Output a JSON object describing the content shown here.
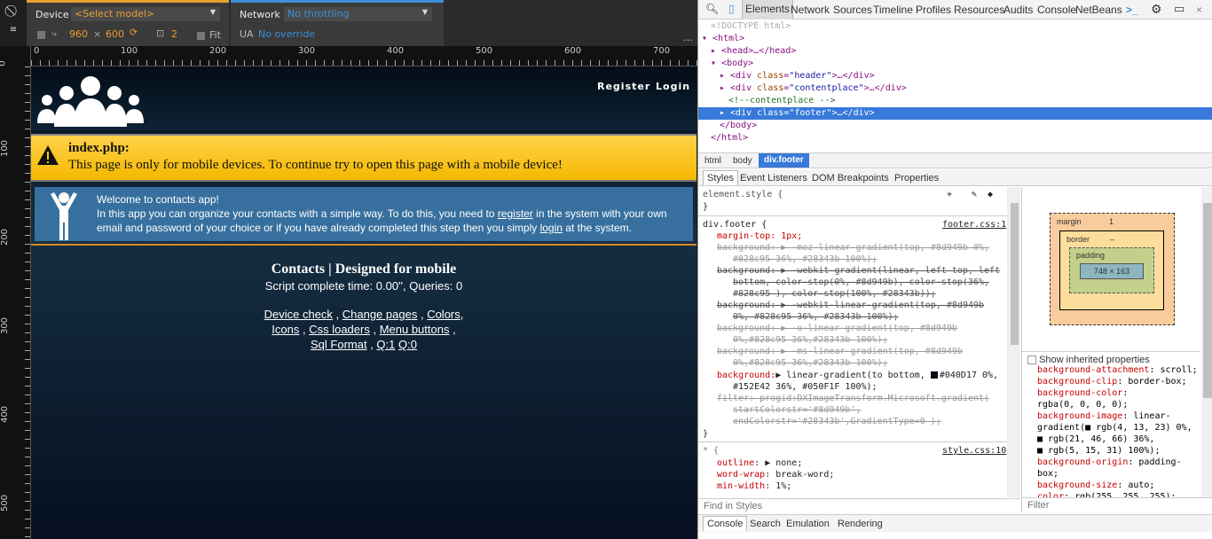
{
  "emulation": {
    "device_label": "Device",
    "device_model": "<Select model>",
    "width": "960",
    "times": "×",
    "height": "600",
    "scale": "2",
    "fit_label": "Fit",
    "network_label": "Network",
    "network_value": "No throttling",
    "ua_label": "UA",
    "ua_value": "No override",
    "accent_device": "#e8a030",
    "accent_network": "#3c8fd8"
  },
  "rulers": {
    "h": [
      "0",
      "100",
      "200",
      "300",
      "400",
      "500",
      "600",
      "700"
    ],
    "v": [
      "0",
      "100",
      "200",
      "300",
      "400",
      "500"
    ]
  },
  "site": {
    "nav": [
      "Register",
      "Login"
    ],
    "warning_title": "index.php:",
    "warning_text": "This page is only for mobile devices. To continue try to open this page with a mobile device!",
    "welcome_title": "Welcome to contacts app!",
    "welcome_p1": "In this app you can organize your contacts with a simple way. To do this, you need to ",
    "welcome_link1": "register",
    "welcome_p2": " in the system with your own",
    "welcome_p3": "email and password of your choice or if you have already completed this step then you simply ",
    "welcome_link2": "login",
    "welcome_p4": " at the system.",
    "footer_title": "Contacts | Designed for mobile",
    "footer_time": "Script complete time: 0.00'', Queries: 0",
    "footer_links": [
      "Device check",
      "Change pages",
      "Colors",
      "Icons",
      "Css loaders",
      "Menu buttons",
      "Sql Format",
      "Q:1",
      "Q:0"
    ]
  },
  "devtools": {
    "tabs": [
      "Elements",
      "Network",
      "Sources",
      "Timeline",
      "Profiles",
      "Resources",
      "Audits",
      "Console",
      "NetBeans"
    ],
    "dom": [
      "<!DOCTYPE html>",
      "<html>",
      "<head>…</head>",
      "<body>",
      "header",
      "contentplace",
      "<!--contentplace -->",
      "footer",
      "</body>",
      "</html>"
    ],
    "breadcrumbs": [
      "html",
      "body",
      "div.footer"
    ],
    "subtabs": [
      "Styles",
      "Event Listeners",
      "DOM Breakpoints",
      "Properties"
    ],
    "rules": {
      "element_style": "element.style {",
      "close": "}",
      "footer_selector": "div.footer {",
      "footer_src": "footer.css:1",
      "l1": "margin-top: 1px;",
      "l2": "background: ▶ -moz-linear-gradient(top, #8d949b 0%,",
      "l3": "#828c95 36%, #28343b 100%);",
      "l4": "background: ▶ -webkit-gradient(linear, left top, left",
      "l5": "bottom, color-stop(0%, #8d949b), color-stop(36%,",
      "l6": "#828c95 ), color-stop(100%, #28343b));",
      "l7": "background: ▶ -webkit-linear-gradient(top, #8d949b",
      "l8": "0%, #828c95 36%, #28343b 100%);",
      "l9": "background: ▶ -o-linear-gradient(top, #8d949b",
      "l10": "0%,#828c95 36%,#28343b 100%);",
      "l11": "background: ▶ -ms-linear-gradient(top, #8d949b",
      "l12": "0%,#828c95 36%,#28343b 100%);",
      "l13a": "background:",
      "l13b": "▶ linear-gradient(to bottom, ",
      "l13c": "#040D17 0%,",
      "l14": "#152E42 36%, #050F1F 100%);",
      "l15": "filter: progid:DXImageTransform.Microsoft.gradient(",
      "l16": "startColorstr='#8d949b',",
      "l17": "endColorstr='#28343b',GradientType=0 );",
      "star_selector": "* {",
      "star_src": "style.css:10",
      "s1a": "outline",
      "s1b": ": ▶ none;",
      "s2a": "word-wrap",
      "s2b": ": break-word;",
      "s3a": "min-width",
      "s3b": ": 1%;"
    },
    "find_placeholder": "Find in Styles",
    "box": {
      "margin": "margin",
      "margin_top": "1",
      "border": "border",
      "padding": "padding",
      "content": "748 × 163",
      "dash": "–"
    },
    "show_inherited": "Show inherited properties",
    "computed": [
      [
        "background-attachment",
        ": scroll;"
      ],
      [
        "background-clip",
        ": border-box;"
      ],
      [
        "background-color",
        ":"
      ],
      [
        "",
        "rgba(0, 0, 0, 0);"
      ],
      [
        "background-image",
        ": linear-"
      ],
      [
        "",
        "gradient(■ rgb(4, 13, 23) 0%,"
      ],
      [
        "",
        "■ rgb(21, 46, 66) 36%,"
      ],
      [
        "",
        "■ rgb(5, 15, 31) 100%);"
      ],
      [
        "background-origin",
        ": padding-"
      ],
      [
        "",
        "box;"
      ],
      [
        "background-size",
        ": auto;"
      ],
      [
        "color",
        ": rgb(255, 255, 255);"
      ]
    ],
    "filter_placeholder": "Filter",
    "drawer_tabs": [
      "Console",
      "Search",
      "Emulation",
      "Rendering"
    ]
  }
}
